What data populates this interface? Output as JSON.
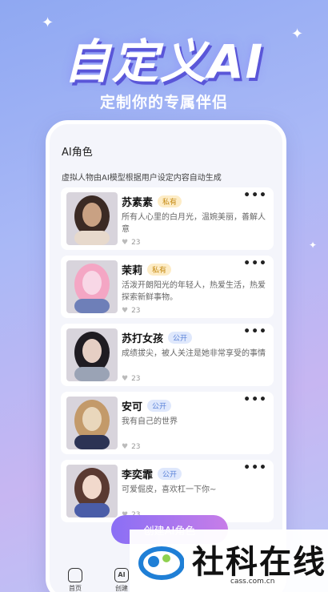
{
  "hero": {
    "title": "自定义AI",
    "subtitle": "定制你的专属伴侣"
  },
  "section": {
    "title": "AI角色",
    "description": "虚拟人物由AI模型根据用户设定内容自动生成"
  },
  "characters": [
    {
      "name": "苏素素",
      "tag": "私有",
      "tag_type": "private",
      "desc": "所有人心里的白月光，温婉美丽，善解人意",
      "likes": "23",
      "avatar_colors": [
        "#3b2a24",
        "#c9a183",
        "#e7d9cc"
      ]
    },
    {
      "name": "茉莉",
      "tag": "私有",
      "tag_type": "private",
      "desc": "活泼开朗阳光的年轻人，热爱生活，热爱探索新鲜事物。",
      "likes": "23",
      "avatar_colors": [
        "#f4a6c4",
        "#f8d7e6",
        "#6e7fb8"
      ]
    },
    {
      "name": "苏打女孩",
      "tag": "公开",
      "tag_type": "public",
      "desc": "成绩拔尖，被人关注是她非常享受的事情",
      "likes": "23",
      "avatar_colors": [
        "#1f1c22",
        "#e6cfc4",
        "#9aa3b5"
      ]
    },
    {
      "name": "安可",
      "tag": "公开",
      "tag_type": "public",
      "desc": "我有自己的世界",
      "likes": "23",
      "avatar_colors": [
        "#c39a6a",
        "#e9d7bc",
        "#2c3354"
      ]
    },
    {
      "name": "李奕霏",
      "tag": "公开",
      "tag_type": "public",
      "desc": "可爱倔皮，喜欢杠一下你~",
      "likes": "23",
      "avatar_colors": [
        "#5a3a32",
        "#f1d9cc",
        "#4a5da8"
      ]
    }
  ],
  "create_button": "创建AI角色",
  "tabs": [
    {
      "label": "首页",
      "icon": "home-icon"
    },
    {
      "label": "创建",
      "icon": "ai-icon"
    }
  ],
  "watermark": {
    "text": "社科在线",
    "url": "cass.com.cn"
  }
}
